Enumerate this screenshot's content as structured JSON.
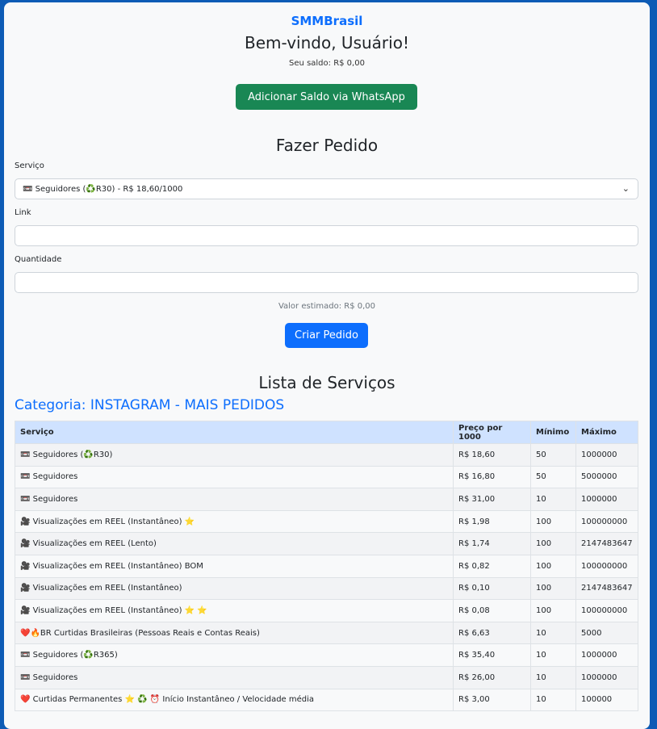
{
  "header": {
    "brand": "SMMBrasil",
    "welcome": "Bem-vindo, Usuário!",
    "balance": "Seu saldo: R$ 0,00",
    "whatsapp_button": "Adicionar Saldo via WhatsApp"
  },
  "order": {
    "title": "Fazer Pedido",
    "service_label": "Serviço",
    "service_selected": "📼 Seguidores (♻️R30) - R$ 18,60/1000",
    "link_label": "Link",
    "link_value": "",
    "quantity_label": "Quantidade",
    "quantity_value": "",
    "estimate": "Valor estimado: R$ 0,00",
    "submit_label": "Criar Pedido"
  },
  "services": {
    "title": "Lista de Serviços",
    "category": "Categoria: INSTAGRAM - MAIS PEDIDOS",
    "columns": [
      "Serviço",
      "Preço por 1000",
      "Mínimo",
      "Máximo"
    ],
    "rows": [
      [
        "📼 Seguidores (♻️R30)",
        "R$ 18,60",
        "50",
        "1000000"
      ],
      [
        "📼 Seguidores",
        "R$ 16,80",
        "50",
        "5000000"
      ],
      [
        "📼 Seguidores",
        "R$ 31,00",
        "10",
        "1000000"
      ],
      [
        "🎥 Visualizações em REEL (Instantâneo) ⭐",
        "R$ 1,98",
        "100",
        "100000000"
      ],
      [
        "🎥 Visualizações em REEL (Lento)",
        "R$ 1,74",
        "100",
        "2147483647"
      ],
      [
        "🎥 Visualizações em REEL (Instantâneo) BOM",
        "R$ 0,82",
        "100",
        "100000000"
      ],
      [
        "🎥 Visualizações em REEL (Instantâneo)",
        "R$ 0,10",
        "100",
        "2147483647"
      ],
      [
        "🎥 Visualizações em REEL (Instantâneo) ⭐ ⭐",
        "R$ 0,08",
        "100",
        "100000000"
      ],
      [
        "❤️🔥BR Curtidas Brasileiras (Pessoas Reais e Contas Reais)",
        "R$ 6,63",
        "10",
        "5000"
      ],
      [
        "📼 Seguidores (♻️R365)",
        "R$ 35,40",
        "10",
        "1000000"
      ],
      [
        "📼 Seguidores",
        "R$ 26,00",
        "10",
        "1000000"
      ],
      [
        "❤️ Curtidas Permanentes ⭐ ♻️ ⏰ Início Instantâneo / Velocidade média",
        "R$ 3,00",
        "10",
        "100000"
      ]
    ]
  },
  "colors": {
    "brand": "#0d6efd",
    "whatsapp_button": "#198754",
    "page_background": "#0d5bb5",
    "table_header": "#cfe2ff"
  }
}
